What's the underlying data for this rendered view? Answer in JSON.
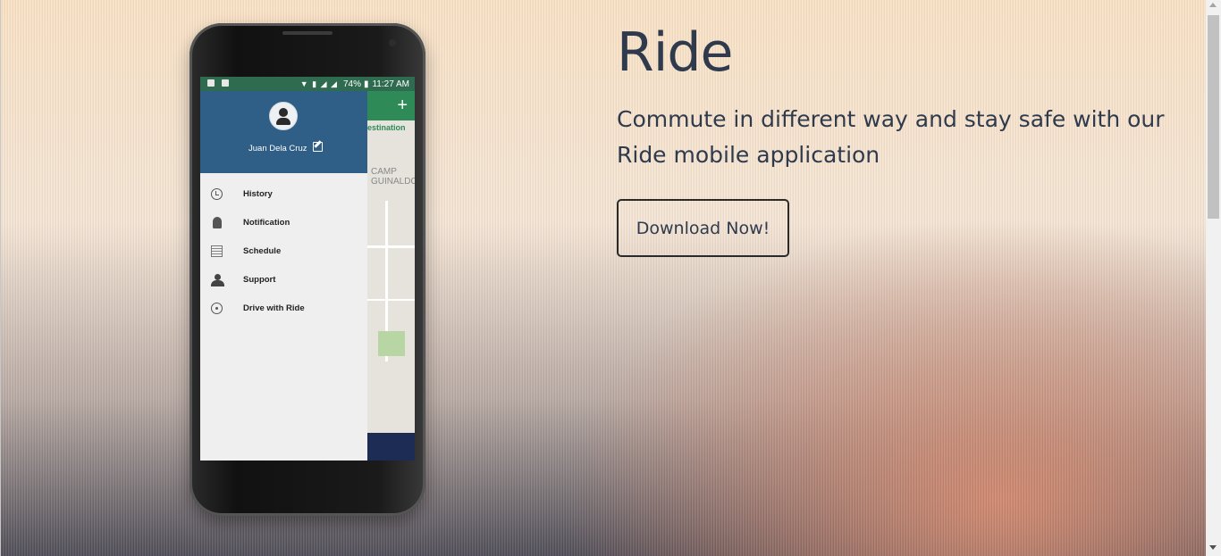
{
  "hero": {
    "title": "Ride",
    "subtitle": "Commute in different way and stay safe with our Ride mobile application",
    "cta_label": "Download Now!"
  },
  "phone": {
    "status": {
      "battery": "74%",
      "time": "11:27 AM"
    },
    "drawer": {
      "user_name": "Juan Dela Cruz",
      "items": [
        {
          "label": "History",
          "icon": "history-icon"
        },
        {
          "label": "Notification",
          "icon": "bell-icon"
        },
        {
          "label": "Schedule",
          "icon": "calendar-icon"
        },
        {
          "label": "Support",
          "icon": "support-agent-icon"
        },
        {
          "label": "Drive with Ride",
          "icon": "steering-wheel-icon"
        }
      ]
    },
    "map": {
      "destination_label": "estination",
      "area_label": "CAMP GUINALDO",
      "plus": "+"
    }
  },
  "colors": {
    "drawer_header": "#2f5f86",
    "status_bar": "#2f6c4f",
    "text": "#2f3b4c"
  }
}
